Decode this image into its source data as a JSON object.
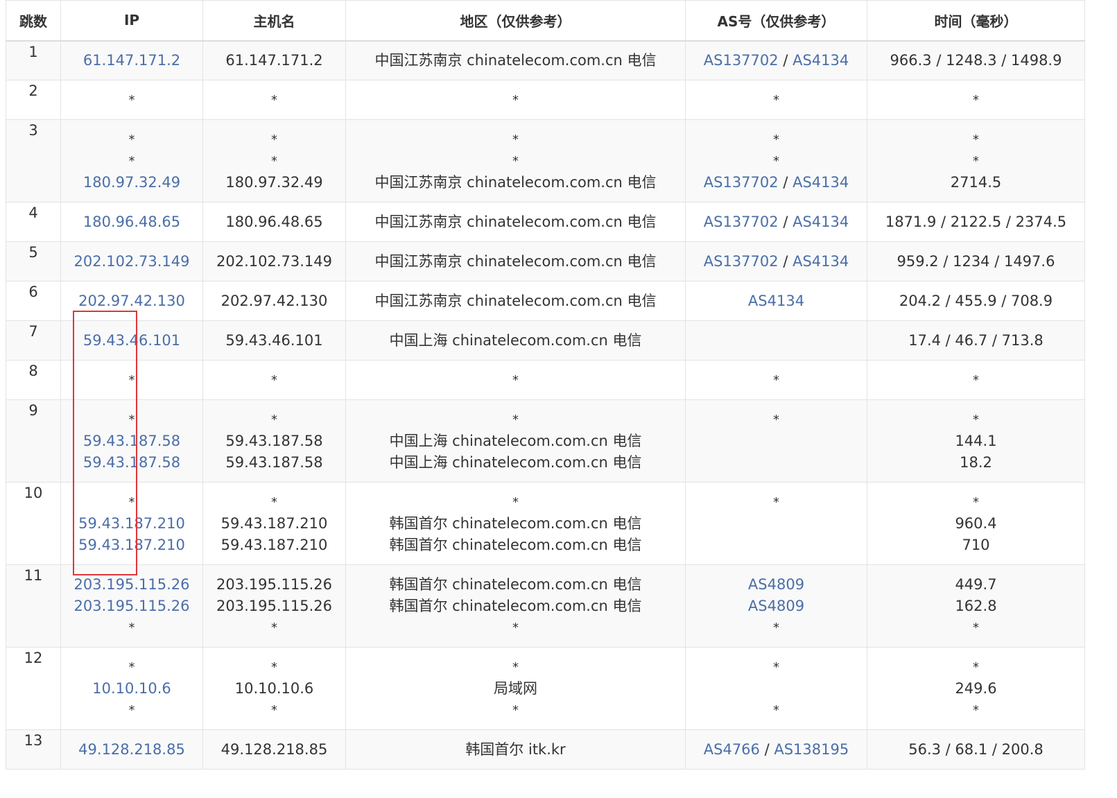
{
  "headers": [
    "跳数",
    "IP",
    "主机名",
    "地区（仅供参考）",
    "AS号（仅供参考）",
    "时间（毫秒）"
  ],
  "accent_color": "#4a6ea8",
  "highlight_color": "#e0353b",
  "rows": [
    {
      "hop": "1",
      "lines": [
        {
          "ip": "61.147.171.2",
          "host": "61.147.171.2",
          "region": "中国江苏南京 chinatelecom.com.cn 电信",
          "as": [
            "AS137702",
            "AS4134"
          ],
          "time": "966.3 / 1248.3 / 1498.9"
        }
      ]
    },
    {
      "hop": "2",
      "lines": [
        {
          "ip": "*",
          "host": "*",
          "region": "*",
          "as": "*",
          "time": "*"
        }
      ]
    },
    {
      "hop": "3",
      "lines": [
        {
          "ip": "*",
          "host": "*",
          "region": "*",
          "as": "*",
          "time": "*"
        },
        {
          "ip": "*",
          "host": "*",
          "region": "*",
          "as": "*",
          "time": "*"
        },
        {
          "ip": "180.97.32.49",
          "host": "180.97.32.49",
          "region": "中国江苏南京 chinatelecom.com.cn 电信",
          "as": [
            "AS137702",
            "AS4134"
          ],
          "time": "2714.5"
        }
      ]
    },
    {
      "hop": "4",
      "lines": [
        {
          "ip": "180.96.48.65",
          "host": "180.96.48.65",
          "region": "中国江苏南京 chinatelecom.com.cn 电信",
          "as": [
            "AS137702",
            "AS4134"
          ],
          "time": "1871.9 / 2122.5 / 2374.5"
        }
      ]
    },
    {
      "hop": "5",
      "lines": [
        {
          "ip": "202.102.73.149",
          "host": "202.102.73.149",
          "region": "中国江苏南京 chinatelecom.com.cn 电信",
          "as": [
            "AS137702",
            "AS4134"
          ],
          "time": "959.2 / 1234 / 1497.6"
        }
      ]
    },
    {
      "hop": "6",
      "lines": [
        {
          "ip": "202.97.42.130",
          "host": "202.97.42.130",
          "region": "中国江苏南京 chinatelecom.com.cn 电信",
          "as": [
            "AS4134"
          ],
          "time": "204.2 / 455.9 / 708.9"
        }
      ]
    },
    {
      "hop": "7",
      "lines": [
        {
          "ip": "59.43.46.101",
          "host": "59.43.46.101",
          "region": "中国上海 chinatelecom.com.cn 电信",
          "as": [],
          "time": "17.4 / 46.7 / 713.8"
        }
      ]
    },
    {
      "hop": "8",
      "lines": [
        {
          "ip": "*",
          "host": "*",
          "region": "*",
          "as": "*",
          "time": "*"
        }
      ]
    },
    {
      "hop": "9",
      "lines": [
        {
          "ip": "*",
          "host": "*",
          "region": "*",
          "as": "*",
          "time": "*"
        },
        {
          "ip": "59.43.187.58",
          "host": "59.43.187.58",
          "region": "中国上海 chinatelecom.com.cn 电信",
          "as": [],
          "time": "144.1"
        },
        {
          "ip": "59.43.187.58",
          "host": "59.43.187.58",
          "region": "中国上海 chinatelecom.com.cn 电信",
          "as": [],
          "time": "18.2"
        }
      ]
    },
    {
      "hop": "10",
      "lines": [
        {
          "ip": "*",
          "host": "*",
          "region": "*",
          "as": "*",
          "time": "*"
        },
        {
          "ip": "59.43.187.210",
          "host": "59.43.187.210",
          "region": "韩国首尔 chinatelecom.com.cn 电信",
          "as": [],
          "time": "960.4"
        },
        {
          "ip": "59.43.187.210",
          "host": "59.43.187.210",
          "region": "韩国首尔 chinatelecom.com.cn 电信",
          "as": [],
          "time": "710"
        }
      ]
    },
    {
      "hop": "11",
      "lines": [
        {
          "ip": "203.195.115.26",
          "host": "203.195.115.26",
          "region": "韩国首尔 chinatelecom.com.cn 电信",
          "as": [
            "AS4809"
          ],
          "time": "449.7"
        },
        {
          "ip": "203.195.115.26",
          "host": "203.195.115.26",
          "region": "韩国首尔 chinatelecom.com.cn 电信",
          "as": [
            "AS4809"
          ],
          "time": "162.8"
        },
        {
          "ip": "*",
          "host": "*",
          "region": "*",
          "as": "*",
          "time": "*"
        }
      ]
    },
    {
      "hop": "12",
      "lines": [
        {
          "ip": "*",
          "host": "*",
          "region": "*",
          "as": "*",
          "time": "*"
        },
        {
          "ip": "10.10.10.6",
          "host": "10.10.10.6",
          "region": "局域网",
          "as": [],
          "time": "249.6"
        },
        {
          "ip": "*",
          "host": "*",
          "region": "*",
          "as": "*",
          "time": "*"
        }
      ]
    },
    {
      "hop": "13",
      "lines": [
        {
          "ip": "49.128.218.85",
          "host": "49.128.218.85",
          "region": "韩国首尔 itk.kr",
          "as": [
            "AS4766",
            "AS138195"
          ],
          "time": "56.3 / 68.1 / 200.8"
        }
      ]
    }
  ]
}
